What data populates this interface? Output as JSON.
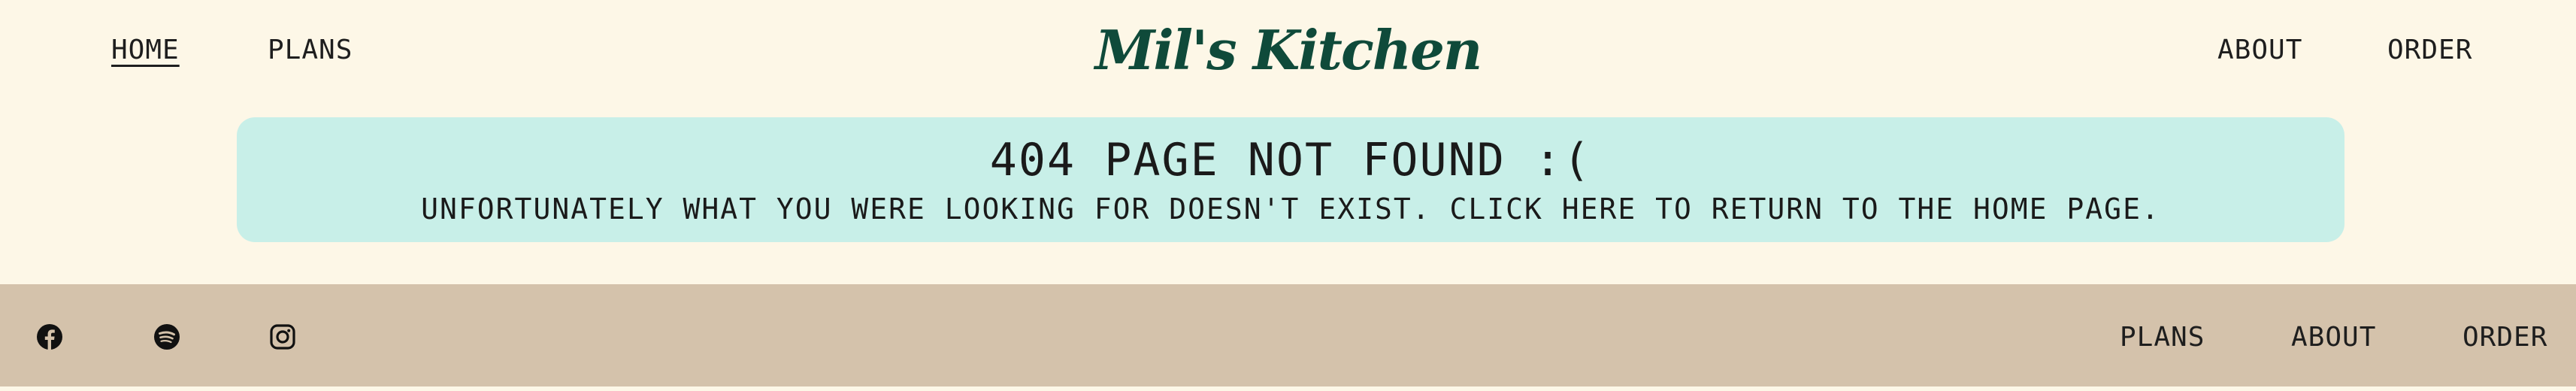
{
  "header": {
    "brand": "Mil's Kitchen",
    "nav": {
      "home": "HOME",
      "plans": "PLANS",
      "about": "ABOUT",
      "order": "ORDER"
    }
  },
  "notice": {
    "title": "404 PAGE NOT FOUND :(",
    "message": "UNFORTUNATELY WHAT YOU WERE LOOKING FOR DOESN'T EXIST. CLICK HERE TO RETURN TO THE HOME PAGE."
  },
  "footer": {
    "social_icons": [
      "facebook-icon",
      "spotify-icon",
      "instagram-icon"
    ],
    "links": {
      "plans": "PLANS",
      "about": "ABOUT",
      "order": "ORDER"
    }
  },
  "colors": {
    "page_background": "#fdf7e7",
    "brand": "#0f4a3a",
    "notice_background": "#c8efe8",
    "footer_background": "#d4c2ab",
    "text": "#1e1e1e"
  }
}
